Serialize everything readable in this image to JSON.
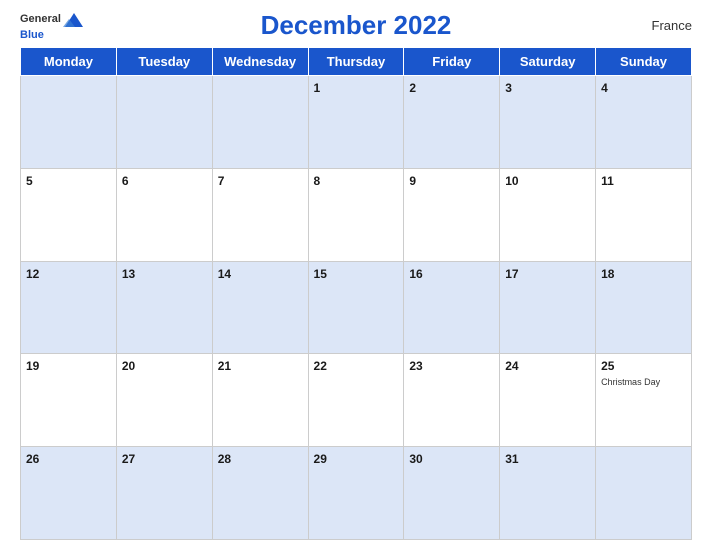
{
  "header": {
    "title": "December 2022",
    "country": "France",
    "logo_general": "General",
    "logo_blue": "Blue"
  },
  "weekdays": [
    "Monday",
    "Tuesday",
    "Wednesday",
    "Thursday",
    "Friday",
    "Saturday",
    "Sunday"
  ],
  "weeks": [
    [
      {
        "day": "",
        "holiday": ""
      },
      {
        "day": "",
        "holiday": ""
      },
      {
        "day": "",
        "holiday": ""
      },
      {
        "day": "1",
        "holiday": ""
      },
      {
        "day": "2",
        "holiday": ""
      },
      {
        "day": "3",
        "holiday": ""
      },
      {
        "day": "4",
        "holiday": ""
      }
    ],
    [
      {
        "day": "5",
        "holiday": ""
      },
      {
        "day": "6",
        "holiday": ""
      },
      {
        "day": "7",
        "holiday": ""
      },
      {
        "day": "8",
        "holiday": ""
      },
      {
        "day": "9",
        "holiday": ""
      },
      {
        "day": "10",
        "holiday": ""
      },
      {
        "day": "11",
        "holiday": ""
      }
    ],
    [
      {
        "day": "12",
        "holiday": ""
      },
      {
        "day": "13",
        "holiday": ""
      },
      {
        "day": "14",
        "holiday": ""
      },
      {
        "day": "15",
        "holiday": ""
      },
      {
        "day": "16",
        "holiday": ""
      },
      {
        "day": "17",
        "holiday": ""
      },
      {
        "day": "18",
        "holiday": ""
      }
    ],
    [
      {
        "day": "19",
        "holiday": ""
      },
      {
        "day": "20",
        "holiday": ""
      },
      {
        "day": "21",
        "holiday": ""
      },
      {
        "day": "22",
        "holiday": ""
      },
      {
        "day": "23",
        "holiday": ""
      },
      {
        "day": "24",
        "holiday": ""
      },
      {
        "day": "25",
        "holiday": "Christmas Day"
      }
    ],
    [
      {
        "day": "26",
        "holiday": ""
      },
      {
        "day": "27",
        "holiday": ""
      },
      {
        "day": "28",
        "holiday": ""
      },
      {
        "day": "29",
        "holiday": ""
      },
      {
        "day": "30",
        "holiday": ""
      },
      {
        "day": "31",
        "holiday": ""
      },
      {
        "day": "",
        "holiday": ""
      }
    ]
  ]
}
